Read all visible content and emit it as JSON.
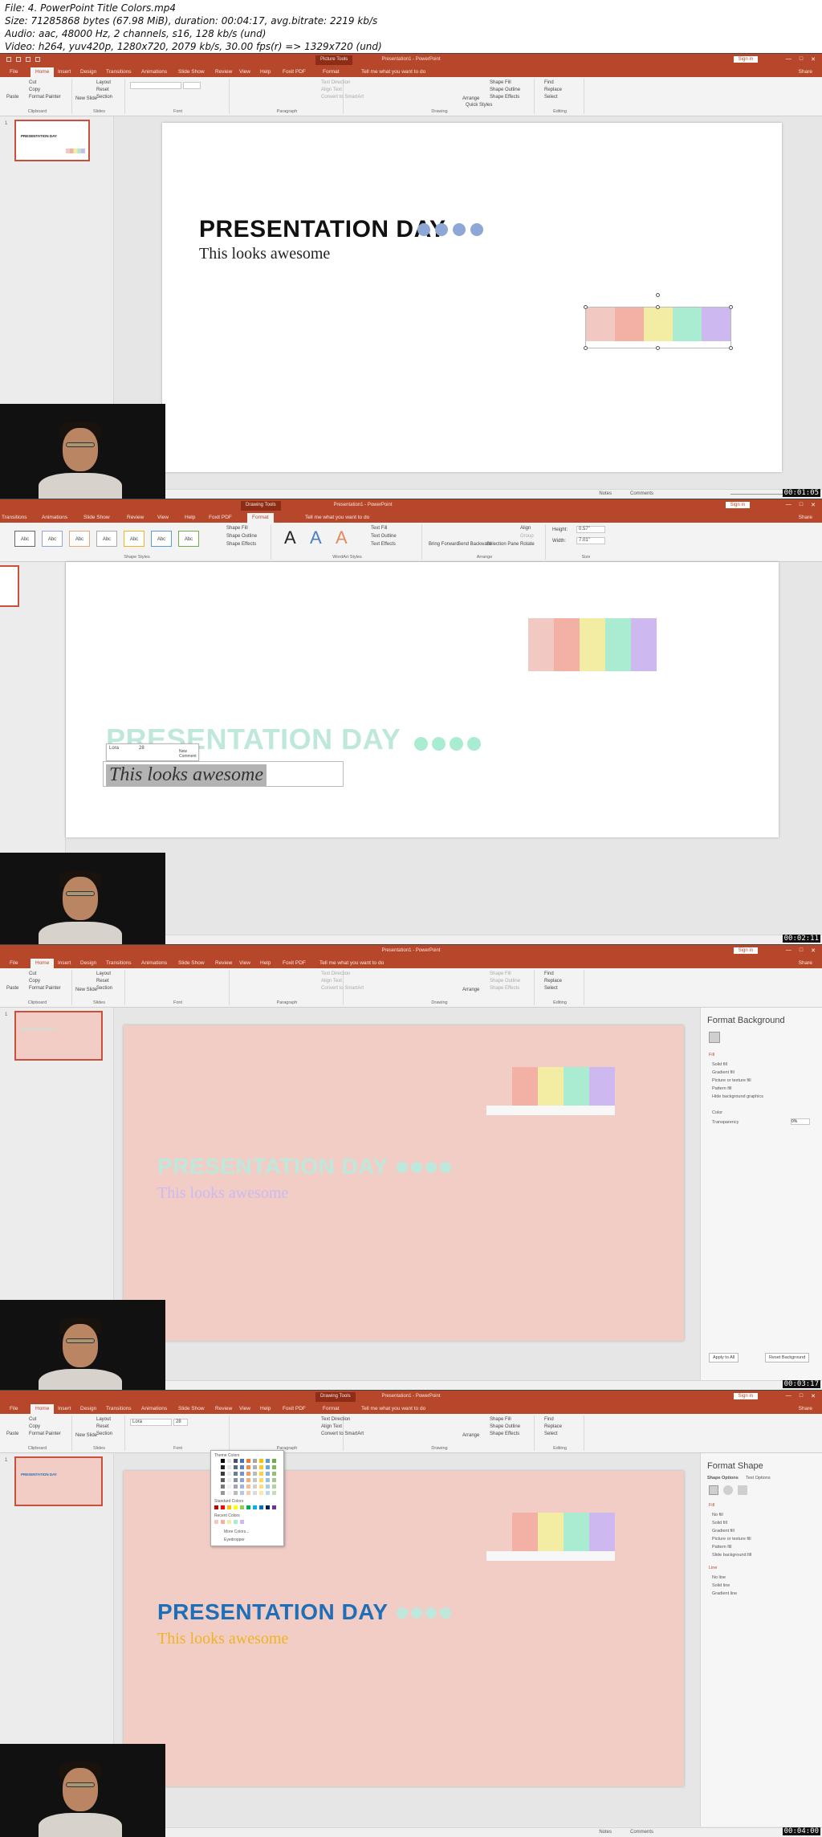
{
  "header": {
    "file": "File: 4. PowerPoint Title Colors.mp4",
    "size": "Size: 71285868 bytes (67.98 MiB), duration: 00:04:17, avg.bitrate: 2219 kb/s",
    "audio": "Audio: aac, 48000 Hz, 2 channels, s16, 128 kb/s (und)",
    "video": "Video: h264, yuv420p, 1280x720, 2079 kb/s, 30.00 fps(r) => 1329x720 (und)"
  },
  "app": {
    "title": "Presentation1 - PowerPoint",
    "context_picture": "Picture Tools",
    "context_drawing": "Drawing Tools",
    "sign_in": "Sign in",
    "share": "Share",
    "tell": "Tell me what you want to do",
    "win_min": "—",
    "win_max": "□",
    "win_close": "✕"
  },
  "tabs_home": [
    "File",
    "Home",
    "Insert",
    "Design",
    "Transitions",
    "Animations",
    "Slide Show",
    "Review",
    "View",
    "Help",
    "Foxit PDF",
    "Format"
  ],
  "tabs_format": [
    "Transitions",
    "Animations",
    "Slide Show",
    "Review",
    "View",
    "Help",
    "Foxit PDF",
    "Format"
  ],
  "ribbon_home": {
    "paste": "Paste",
    "cut": "Cut",
    "copy": "Copy",
    "format_painter": "Format Painter",
    "clipboard": "Clipboard",
    "new_slide": "New Slide",
    "layout": "Layout",
    "reset": "Reset",
    "section": "Section",
    "slides": "Slides",
    "font": "Font",
    "paragraph": "Paragraph",
    "text_direction": "Text Direction",
    "align_text": "Align Text",
    "convert_smartart": "Convert to SmartArt",
    "drawing": "Drawing",
    "arrange": "Arrange",
    "quick_styles": "Quick Styles",
    "shape_fill": "Shape Fill",
    "shape_outline": "Shape Outline",
    "shape_effects": "Shape Effects",
    "find": "Find",
    "replace": "Replace",
    "select": "Select",
    "editing": "Editing",
    "font_name": "Lora",
    "font_size": "28"
  },
  "ribbon_format": {
    "shape_styles": "Shape Styles",
    "abc": "Abc",
    "shape_fill": "Shape Fill",
    "shape_outline": "Shape Outline",
    "shape_effects": "Shape Effects",
    "wordart_styles": "WordArt Styles",
    "wordart_a": "A",
    "text_fill": "Text Fill",
    "text_outline": "Text Outline",
    "text_effects": "Text Effects",
    "bring_forward": "Bring Forward",
    "send_backward": "Send Backward",
    "selection_pane": "Selection Pane",
    "align": "Align",
    "group": "Group",
    "rotate": "Rotate",
    "arrange": "Arrange",
    "height_label": "Height:",
    "height": "0.57\"",
    "width_label": "Width:",
    "width": "7.01\"",
    "size": "Size"
  },
  "slide": {
    "title": "PRESENTATION DAY",
    "subtitle": "This looks awesome",
    "thumb_title": "PRESENTATION DAY",
    "thumb_sub": "This looks awesome"
  },
  "palette_swatches": [
    "#f1c9c2",
    "#f2b1a4",
    "#f3eda3",
    "#a9ecd1",
    "#cdb9ef"
  ],
  "colors": {
    "accent": "#b7472a",
    "dot_blue": "#8ea7d6",
    "dot_green": "#a9ecd1",
    "slide_bg_pink": "#f1cdc6",
    "title_teal_light": "#bfe8dd",
    "sub_purple_light": "#cdb9ef",
    "title_blue": "#1f6fb8",
    "sub_orange": "#f0b323"
  },
  "mini_toolbar": {
    "font": "Lora",
    "size": "28",
    "new_comment": "New Comment"
  },
  "status": {
    "notes": "Notes",
    "comments": "Comments",
    "slide_num": "1"
  },
  "format_background": {
    "title": "Format Background",
    "fill": "Fill",
    "solid": "Solid fill",
    "gradient": "Gradient fill",
    "picture": "Picture or texture fill",
    "pattern": "Pattern fill",
    "hide_bg": "Hide background graphics",
    "color": "Color",
    "transparency": "Transparency",
    "transparency_value": "0%",
    "apply_all": "Apply to All",
    "reset_bg": "Reset Background"
  },
  "format_shape": {
    "title": "Format Shape",
    "shape_options": "Shape Options",
    "text_options": "Text Options",
    "fill": "Fill",
    "no_fill": "No fill",
    "solid": "Solid fill",
    "gradient": "Gradient fill",
    "picture": "Picture or texture fill",
    "pattern": "Pattern fill",
    "slide_bg": "Slide background fill",
    "line": "Line",
    "no_line": "No line",
    "solid_line": "Solid line",
    "gradient_line": "Gradient line"
  },
  "color_menu": {
    "theme_colors": "Theme Colors",
    "standard_colors": "Standard Colors",
    "recent_colors": "Recent Colors",
    "more_colors": "More Colors...",
    "eyedropper": "Eyedropper"
  },
  "timestamps": [
    "00:01:05",
    "00:02:11",
    "00:03:17",
    "00:04:00"
  ]
}
